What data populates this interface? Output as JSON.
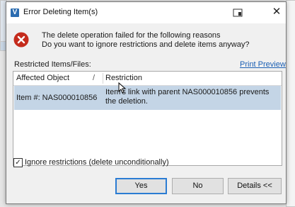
{
  "window": {
    "title": "Error Deleting Item(s)",
    "app_icon_letter": "V"
  },
  "message": {
    "line1": "The delete operation failed for the following reasons",
    "line2": "Do you want to ignore restrictions and delete items anyway?"
  },
  "restricted_label": "Restricted Items/Files:",
  "print_preview": "Print Preview",
  "table": {
    "headers": {
      "affected_object": "Affected Object",
      "sort": "/",
      "restriction": "Restriction"
    },
    "rows": [
      {
        "affected_object": "Item #: NAS000010856",
        "restriction": "Item's link with parent NAS000010856 prevents the deletion."
      }
    ]
  },
  "ignore_checkbox": {
    "label": "Ignore restrictions (delete unconditionally)",
    "checked": true,
    "mark": "✓"
  },
  "buttons": {
    "yes": "Yes",
    "no": "No",
    "details": "Details <<"
  },
  "colors": {
    "selected_row": "#c4d5e6",
    "error_icon": "#c42b1c",
    "link": "#1a5fb4"
  }
}
